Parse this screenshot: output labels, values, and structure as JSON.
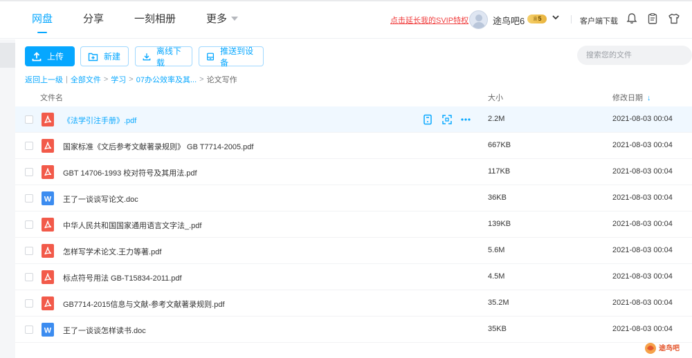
{
  "nav": {
    "items": [
      {
        "label": "网盘",
        "active": true
      },
      {
        "label": "分享",
        "active": false
      },
      {
        "label": "一刻相册",
        "active": false
      },
      {
        "label": "更多",
        "active": false
      }
    ]
  },
  "header": {
    "svip_promo": "点击延长我的SVIP特权",
    "username": "途鸟吧6",
    "vip_level": "5",
    "client_download": "客户端下载"
  },
  "toolbar": {
    "upload": "上传",
    "new": "新建",
    "offline_download": "离线下载",
    "push_device": "推送到设备",
    "search_placeholder": "搜索您的文件"
  },
  "breadcrumb": {
    "back": "返回上一级",
    "all_files": "全部文件",
    "path": [
      "学习",
      "07办公效率及其..."
    ],
    "current": "论文写作"
  },
  "table": {
    "col_name": "文件名",
    "col_size": "大小",
    "col_date": "修改日期",
    "sort_arrow": "↓",
    "rows": [
      {
        "name": "《法学引注手册》.pdf",
        "size": "2.2M",
        "date": "2021-08-03 00:04",
        "type": "pdf"
      },
      {
        "name": "国家标准《文后参考文献著录规则》 GB T7714-2005.pdf",
        "size": "667KB",
        "date": "2021-08-03 00:04",
        "type": "pdf"
      },
      {
        "name": "GBT 14706-1993 校对符号及其用法.pdf",
        "size": "117KB",
        "date": "2021-08-03 00:04",
        "type": "pdf"
      },
      {
        "name": "王了一谈谈写论文.doc",
        "size": "36KB",
        "date": "2021-08-03 00:04",
        "type": "doc"
      },
      {
        "name": "中华人民共和国国家通用语言文字法_.pdf",
        "size": "139KB",
        "date": "2021-08-03 00:04",
        "type": "pdf"
      },
      {
        "name": "怎样写学术论文.王力等著.pdf",
        "size": "5.6M",
        "date": "2021-08-03 00:04",
        "type": "pdf"
      },
      {
        "name": "标点符号用法 GB-T15834-2011.pdf",
        "size": "4.5M",
        "date": "2021-08-03 00:04",
        "type": "pdf"
      },
      {
        "name": "GB7714-2015信息与文献-参考文献著录规则.pdf",
        "size": "35.2M",
        "date": "2021-08-03 00:04",
        "type": "pdf"
      },
      {
        "name": "王了一谈谈怎样读书.doc",
        "size": "35KB",
        "date": "2021-08-03 00:04",
        "type": "doc"
      }
    ]
  },
  "watermark": {
    "text": "途鸟吧"
  },
  "colors": {
    "accent": "#06a7ff",
    "pdf": "#f25a4a",
    "doc": "#3c8cf0",
    "promo": "#f03e3e"
  }
}
